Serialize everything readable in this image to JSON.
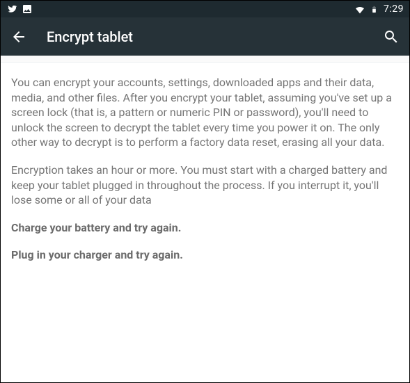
{
  "status": {
    "clock": "7:29"
  },
  "toolbar": {
    "title": "Encrypt tablet"
  },
  "body": {
    "p1": "You can encrypt your accounts, settings, downloaded apps and their data, media, and other files. After you encrypt your tablet, assuming you've set up a screen lock (that is, a pattern or numeric PIN or password), you'll need to unlock the screen to decrypt the tablet every time you power it on. The only other way to decrypt is to perform a factory data reset, erasing all your data.",
    "p2": "Encryption takes an hour or more. You must start with a charged battery and keep your tablet plugged in throughout the process. If you interrupt it, you'll lose some or all of your data",
    "warn1": "Charge your battery and try again.",
    "warn2": "Plug in your charger and try again."
  }
}
